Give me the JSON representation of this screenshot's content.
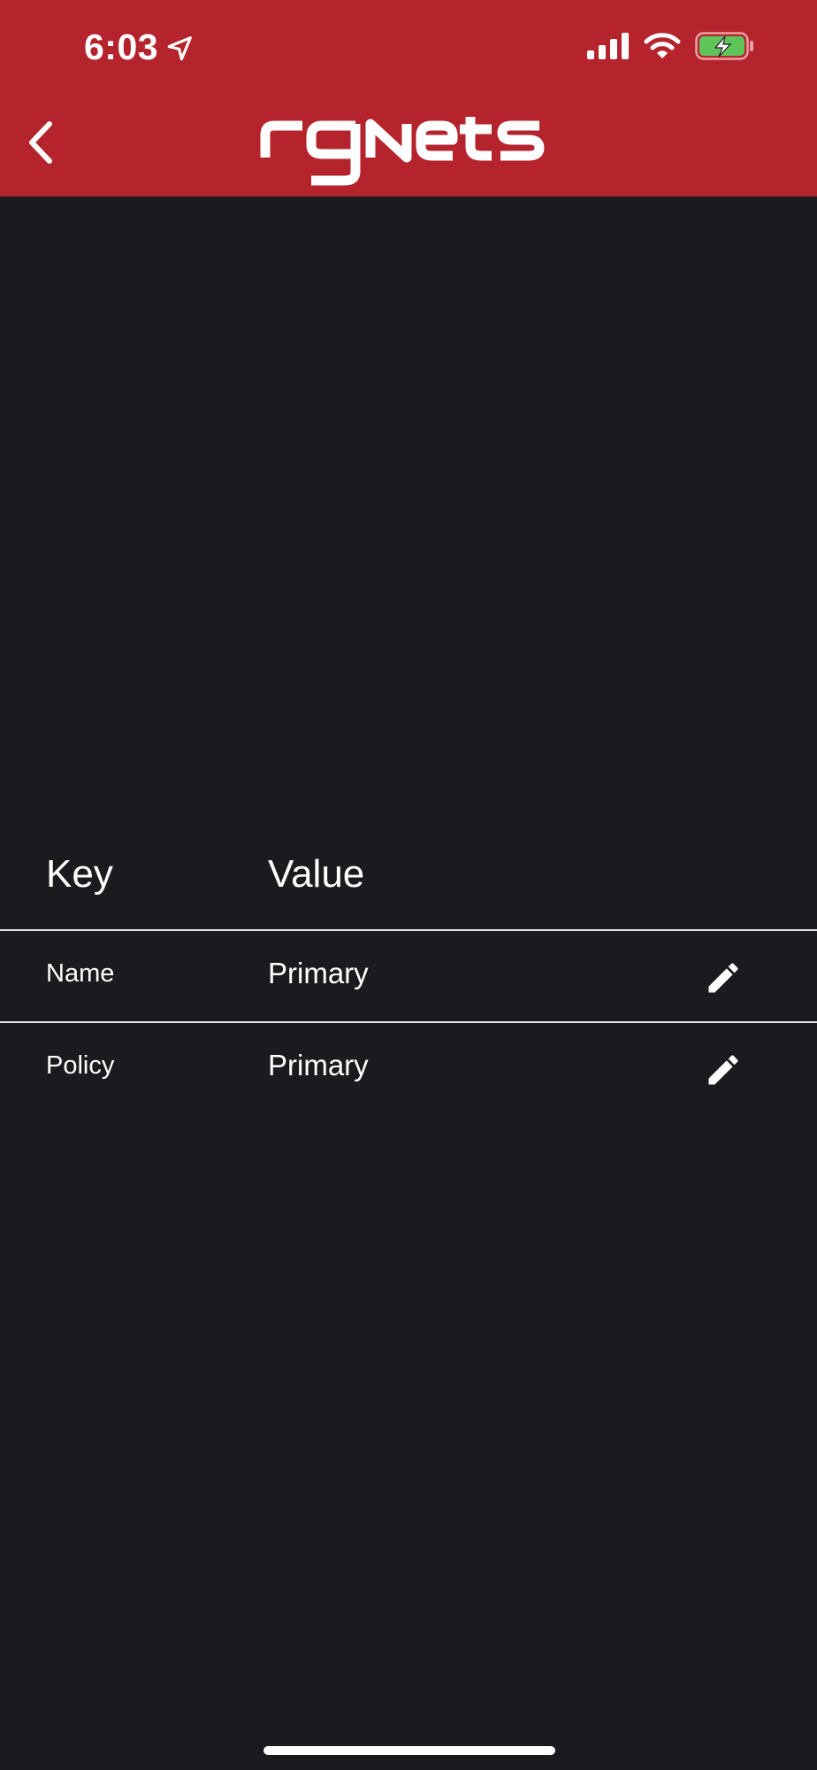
{
  "status_bar": {
    "time": "6:03",
    "location_icon": "location-arrow-icon",
    "signal_icon": "cellular-signal-icon",
    "wifi_icon": "wifi-icon",
    "battery_icon": "battery-charging-icon"
  },
  "header": {
    "back_icon": "chevron-left-icon",
    "logo_text": "rgNets",
    "background_color": "#b5232d"
  },
  "table": {
    "columns": {
      "key": "Key",
      "value": "Value"
    },
    "rows": [
      {
        "key": "Name",
        "value": "Primary",
        "action_icon": "pencil-icon"
      },
      {
        "key": "Policy",
        "value": "Primary",
        "action_icon": "pencil-icon"
      }
    ]
  },
  "colors": {
    "page_background": "#1b1b1f",
    "text": "#ffffff",
    "battery_fill": "#5fc55b"
  }
}
